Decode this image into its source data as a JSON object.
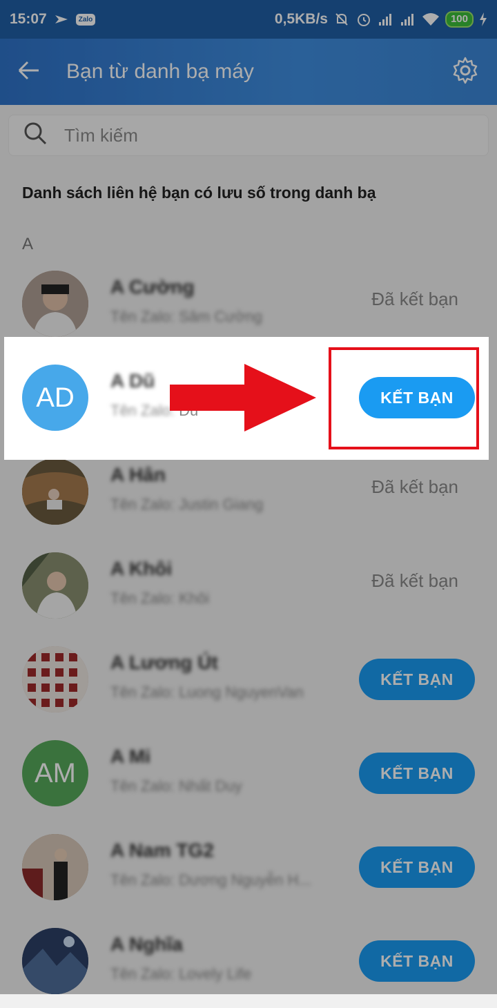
{
  "status_bar": {
    "time": "15:07",
    "network_speed": "0,5KB/s",
    "battery": "100",
    "app_badge": "Zalo",
    "icons": [
      "arrow-app-icon",
      "zalo-app-icon",
      "mute-icon",
      "alarm-icon",
      "signal-icon",
      "signal-icon",
      "wifi-icon",
      "battery-icon",
      "charging-icon"
    ]
  },
  "header": {
    "title": "Bạn từ danh bạ máy",
    "back_icon": "back-arrow-icon",
    "settings_icon": "gear-icon"
  },
  "search": {
    "placeholder": "Tìm kiếm",
    "icon": "search-icon"
  },
  "description": "Danh sách liên hệ bạn có lưu số trong danh bạ",
  "section_letter": "A",
  "contacts": [
    {
      "name": "A Cường",
      "zalo_prefix": "Tên Zalo:",
      "zalo_name": "Sâm Cường",
      "status": "Đã kết bạn",
      "avatar_color": "#8a6e5e"
    },
    {
      "name": "A Dũ",
      "zalo_prefix": "Tên Zalo:",
      "zalo_name": "Dũ",
      "action": "KẾT BẠN",
      "avatar_initials": "AD",
      "avatar_color": "#47a8ea"
    },
    {
      "name": "A Hân",
      "zalo_prefix": "Tên Zalo:",
      "zalo_name": "Justin Giang",
      "status": "Đã kết bạn",
      "avatar_color": "#6f6a4e"
    },
    {
      "name": "A Khôi",
      "zalo_prefix": "Tên Zalo:",
      "zalo_name": "Khôi",
      "status": "Đã kết bạn",
      "avatar_color": "#7a8166"
    },
    {
      "name": "A Lương Út",
      "zalo_prefix": "Tên Zalo:",
      "zalo_name": "Luong NguyenVan",
      "action": "KẾT BẠN",
      "avatar_color": "#c9a7a0"
    },
    {
      "name": "A Mi",
      "zalo_prefix": "Tên Zalo:",
      "zalo_name": "Nhất Duy",
      "action": "KẾT BẠN",
      "avatar_initials": "AM",
      "avatar_color": "#56a85a"
    },
    {
      "name": "A Nam TG2",
      "zalo_prefix": "Tên Zalo:",
      "zalo_name": "Dương Nguyễn H...",
      "action": "KẾT BẠN",
      "avatar_color": "#9c7f68"
    },
    {
      "name": "A Nghĩa",
      "zalo_prefix": "Tên Zalo:",
      "zalo_name": "Lovely Life",
      "action": "KẾT BẠN",
      "avatar_color": "#3a4f72"
    }
  ],
  "colors": {
    "header_start": "#2f73c9",
    "header_end": "#3b86d6",
    "add_button": "#1a9bf2",
    "highlight_red": "#e5101a"
  }
}
